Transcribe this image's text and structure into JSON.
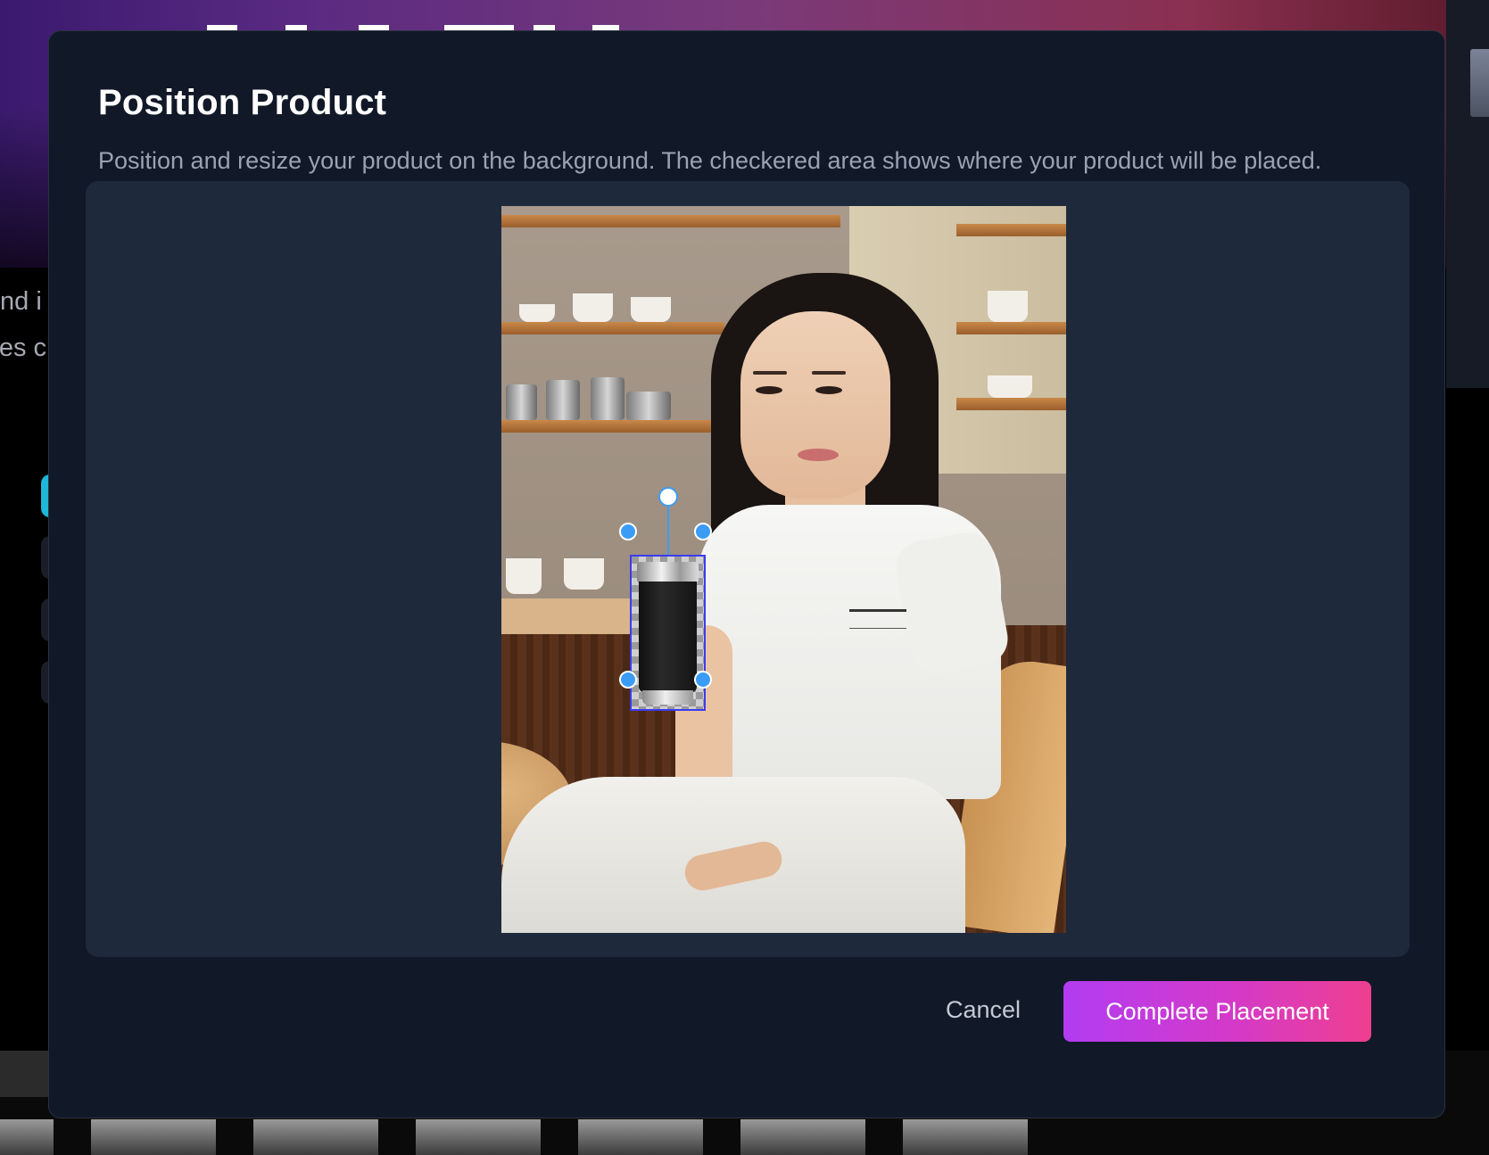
{
  "background_page": {
    "line_1_fragment": "nd i",
    "line_2_fragment": "es c"
  },
  "modal": {
    "title": "Position Product",
    "description": "Position and resize your product on the background. The checkered area shows where your product will be placed.",
    "cancel_label": "Cancel",
    "complete_label": "Complete Placement"
  },
  "placement": {
    "selection_color": "#3b3bf0",
    "handle_color": "#3b9cf6"
  },
  "icons": {
    "rotate": "rotate-handle-icon",
    "resize": "resize-handle-icon"
  },
  "colors": {
    "modal_bg": "#111827",
    "canvas_bg": "#1e293b",
    "accent_gradient_start": "#b23cf2",
    "accent_gradient_end": "#ee3f90"
  }
}
